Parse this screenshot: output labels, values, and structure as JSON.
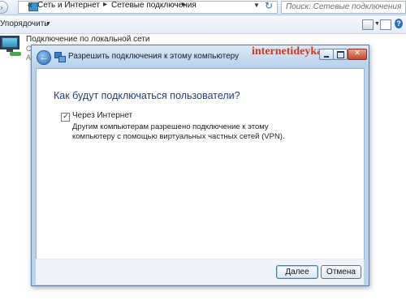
{
  "explorer": {
    "breadcrumb": {
      "prefix": "«",
      "items": [
        "Сеть и Интернет",
        "Сетевые подключения"
      ]
    },
    "search_placeholder": "Поиск: Сетевые подключения",
    "toolbar": {
      "organize_label": "Упорядочить"
    },
    "connection": {
      "name": "Подключение по локальной сети",
      "line2": "С",
      "line3": "А"
    }
  },
  "dialog": {
    "title": "Разрешить подключения к этому компьютеру",
    "watermark": "internetideyka.ru",
    "heading": "Как будут подключаться пользователи?",
    "option": {
      "label": "Через Интернет",
      "checked": true,
      "description": "Другим компьютерам разрешено подключение к этому компьютеру с помощью виртуальных частных сетей (VPN)."
    },
    "buttons": {
      "next": "Далее",
      "cancel": "Отмена"
    }
  },
  "icons": {
    "back": "back-arrow-icon",
    "network": "network-connection-icon",
    "local-connection": "monitor-network-icon"
  },
  "colors": {
    "heading": "#1f3f7a",
    "watermark": "#c43a1e",
    "close_button": "#c4452a",
    "dialog_frame": "#bcd3ea"
  }
}
